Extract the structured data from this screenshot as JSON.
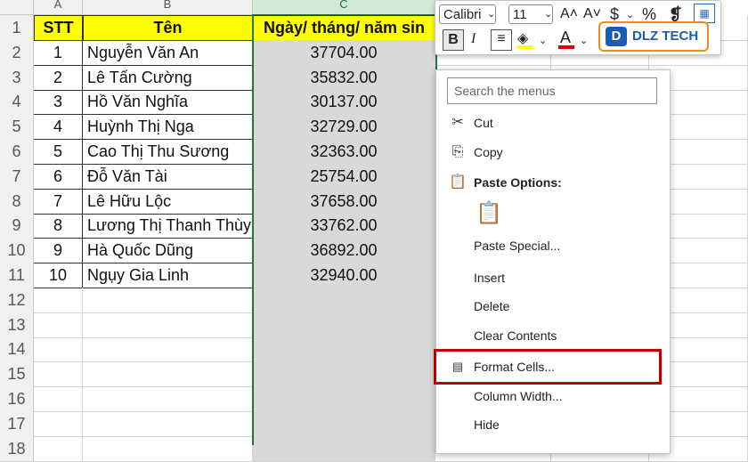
{
  "columns": [
    "A",
    "B",
    "C"
  ],
  "header_row": {
    "stt": "STT",
    "ten": "Tên",
    "ngay": "Ngày/ tháng/ năm sin"
  },
  "rows": [
    {
      "num": "1",
      "stt": "",
      "ten": "",
      "ngay": ""
    },
    {
      "num": "2",
      "stt": "1",
      "ten": "Nguyễn Văn An",
      "ngay": "37704.00"
    },
    {
      "num": "3",
      "stt": "2",
      "ten": "Lê Tấn Cường",
      "ngay": "35832.00"
    },
    {
      "num": "4",
      "stt": "3",
      "ten": "Hồ Văn Nghĩa",
      "ngay": "30137.00"
    },
    {
      "num": "5",
      "stt": "4",
      "ten": "Huỳnh Thị Nga",
      "ngay": "32729.00"
    },
    {
      "num": "6",
      "stt": "5",
      "ten": "Cao Thị Thu Sương",
      "ngay": "32363.00"
    },
    {
      "num": "7",
      "stt": "6",
      "ten": "Đỗ Văn Tài",
      "ngay": "25754.00"
    },
    {
      "num": "8",
      "stt": "7",
      "ten": "Lê Hữu Lộc",
      "ngay": "37658.00"
    },
    {
      "num": "9",
      "stt": "8",
      "ten": "Lương Thị Thanh Thùy",
      "ngay": "33762.00"
    },
    {
      "num": "10",
      "stt": "9",
      "ten": "Hà Quốc Dũng",
      "ngay": "36892.00"
    },
    {
      "num": "11",
      "stt": "10",
      "ten": "Ngụy Gia Linh",
      "ngay": "32940.00"
    },
    {
      "num": "12"
    },
    {
      "num": "13"
    },
    {
      "num": "14"
    },
    {
      "num": "15"
    },
    {
      "num": "16"
    },
    {
      "num": "17"
    },
    {
      "num": "18"
    }
  ],
  "mini_toolbar": {
    "font_name": "Calibri",
    "font_size": "11",
    "grow": "A˄",
    "shrink": "A˅",
    "currency": "$",
    "percent": "%",
    "comma": "❡",
    "bold": "B",
    "italic": "I"
  },
  "watermark": "DLZ TECH",
  "context_menu": {
    "search_placeholder": "Search the menus",
    "items": {
      "cut": "Cut",
      "copy": "Copy",
      "paste_options": "Paste Options:",
      "paste_special": "Paste Special...",
      "insert": "Insert",
      "delete": "Delete",
      "clear_contents": "Clear Contents",
      "format_cells": "Format Cells...",
      "column_width": "Column Width...",
      "hide": "Hide"
    }
  },
  "colors": {
    "header_fill": "#ffff00",
    "selected_column": "#d9d9d9",
    "highlight_box": "#c00000",
    "accent": "#217346"
  }
}
